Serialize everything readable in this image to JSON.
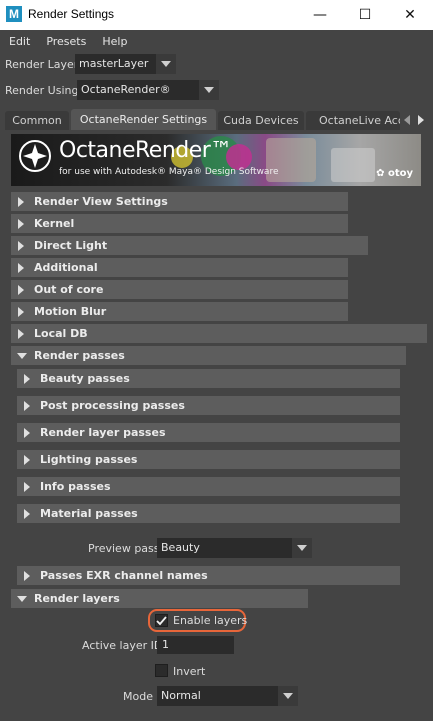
{
  "window": {
    "app_icon": "M",
    "title": "Render Settings",
    "minimize_glyph": "—",
    "maximize_glyph": "☐",
    "close_glyph": "✕"
  },
  "menu": [
    "Edit",
    "Presets",
    "Help"
  ],
  "render_layer": {
    "label": "Render Layer",
    "value": "masterLayer"
  },
  "render_using": {
    "label": "Render Using",
    "value": "OctaneRender®"
  },
  "tabs": [
    {
      "label": "Common"
    },
    {
      "label": "OctaneRender Settings"
    },
    {
      "label": "Cuda Devices"
    },
    {
      "label": "OctaneLive Acco"
    }
  ],
  "banner": {
    "brand": "OctaneRender™",
    "tagline": "for use with Autodesk® Maya® Design Software",
    "otoy": "✿ otoy"
  },
  "sections": [
    {
      "label": "Render View Settings"
    },
    {
      "label": "Kernel"
    },
    {
      "label": "Direct Light"
    },
    {
      "label": "Additional"
    },
    {
      "label": "Out of core"
    },
    {
      "label": "Motion Blur"
    },
    {
      "label": "Local DB"
    },
    {
      "label": "Render passes"
    }
  ],
  "subsections": [
    {
      "label": "Beauty passes"
    },
    {
      "label": "Post processing passes"
    },
    {
      "label": "Render layer passes"
    },
    {
      "label": "Lighting passes"
    },
    {
      "label": "Info passes"
    },
    {
      "label": "Material passes"
    }
  ],
  "preview_pass": {
    "label": "Preview pass",
    "value": "Beauty"
  },
  "passes_exr": {
    "label": "Passes EXR channel names"
  },
  "render_layers": {
    "label": "Render layers",
    "enable_layers": {
      "label": "Enable layers",
      "checked": true
    },
    "active_layer_id": {
      "label": "Active layer ID",
      "value": "1"
    },
    "invert": {
      "label": "Invert",
      "checked": false
    },
    "mode": {
      "label": "Mode",
      "value": "Normal"
    }
  },
  "colors": {
    "accent_highlight": "#e8663a",
    "panel": "#444444",
    "section": "#5d5d5d"
  }
}
